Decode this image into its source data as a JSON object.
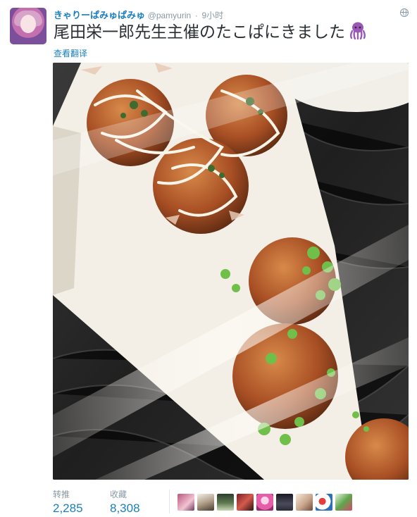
{
  "tweet": {
    "display_name": "きゃりーぱみゅぱみゅ",
    "handle": "@pamyurin",
    "separator": "·",
    "time": "9小时",
    "text": "尾田栄一郎先生主催のたこぱにきました",
    "emoji_icon": "octopus-icon",
    "translate_label": "查看翻译",
    "photo_subject": ""
  },
  "stats": {
    "retweets_label": "转推",
    "retweets_count": "2,285",
    "likes_label": "收藏",
    "likes_count": "8,308"
  },
  "likers": [
    {
      "name": "liker-avatar"
    },
    {
      "name": "liker-avatar"
    },
    {
      "name": "liker-avatar"
    },
    {
      "name": "liker-avatar"
    },
    {
      "name": "liker-avatar"
    },
    {
      "name": "liker-avatar"
    },
    {
      "name": "liker-avatar"
    },
    {
      "name": "liker-avatar"
    },
    {
      "name": "liker-avatar"
    }
  ],
  "colors": {
    "link": "#1b7fbd",
    "muted": "#8899a6",
    "text": "#292f33",
    "octopus": "#9b59b6"
  }
}
